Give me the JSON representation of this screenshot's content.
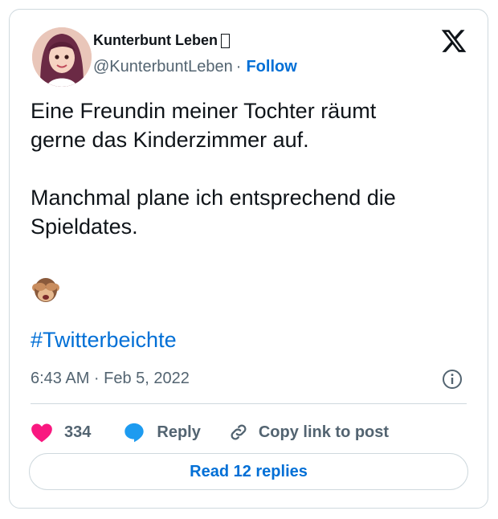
{
  "author": {
    "display_name": "Kunterbunt Leben",
    "handle": "@KunterbuntLeben",
    "separator": "·",
    "follow_label": "Follow"
  },
  "tweet": {
    "text": "Eine Freundin meiner Tochter räumt\ngerne das Kinderzimmer auf.\n\nManchmal plane ich entsprechend die\nSpieldates.",
    "emoji": "see-no-evil-monkey",
    "hashtag": "#Twitterbeichte",
    "timestamp": "6:43 AM · Feb 5, 2022"
  },
  "actions": {
    "like_count": "334",
    "reply_label": "Reply",
    "copy_label": "Copy link to post"
  },
  "read_replies_label": "Read 12 replies",
  "colors": {
    "link": "#006fd6",
    "secondary_text": "#536471",
    "like": "#f91880",
    "reply": "#1d9bf0",
    "border": "#cfd9de"
  },
  "icons": [
    "avatar",
    "x-logo",
    "see-no-evil-monkey-icon",
    "info-icon",
    "heart-icon",
    "reply-bubble-icon",
    "link-icon"
  ]
}
